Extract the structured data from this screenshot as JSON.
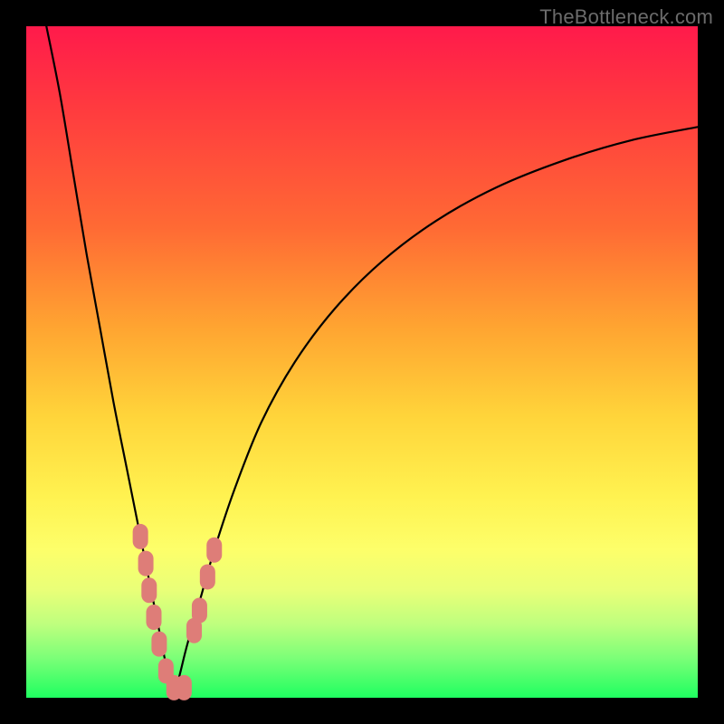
{
  "watermark": "TheBottleneck.com",
  "colors": {
    "frame": "#000000",
    "curve": "#000000",
    "marker": "#de7d78",
    "gradient_top": "#ff1a4b",
    "gradient_bottom": "#1fff60"
  },
  "chart_data": {
    "type": "line",
    "title": "",
    "xlabel": "",
    "ylabel": "",
    "xlim": [
      0,
      100
    ],
    "ylim": [
      0,
      100
    ],
    "notch_x": 22,
    "curve_left": {
      "x": [
        3,
        5,
        7,
        9,
        11,
        13,
        15,
        17,
        18,
        19,
        20,
        21,
        22
      ],
      "y": [
        100,
        90,
        78,
        66,
        55,
        44,
        34,
        24,
        19,
        14,
        9,
        4,
        0
      ]
    },
    "curve_right": {
      "x": [
        22,
        23,
        24,
        26,
        28,
        31,
        35,
        40,
        46,
        53,
        61,
        70,
        80,
        90,
        100
      ],
      "y": [
        0,
        4,
        8,
        15,
        22,
        31,
        41,
        50,
        58,
        65,
        71,
        76,
        80,
        83,
        85
      ]
    },
    "markers_left": [
      {
        "x": 17.0,
        "y": 24
      },
      {
        "x": 17.8,
        "y": 20
      },
      {
        "x": 18.3,
        "y": 16
      },
      {
        "x": 19.0,
        "y": 12
      },
      {
        "x": 19.8,
        "y": 8
      },
      {
        "x": 20.8,
        "y": 4
      },
      {
        "x": 22.0,
        "y": 1.5
      },
      {
        "x": 23.5,
        "y": 1.5
      }
    ],
    "markers_right": [
      {
        "x": 25.0,
        "y": 10
      },
      {
        "x": 25.8,
        "y": 13
      },
      {
        "x": 27.0,
        "y": 18
      },
      {
        "x": 28.0,
        "y": 22
      }
    ]
  }
}
